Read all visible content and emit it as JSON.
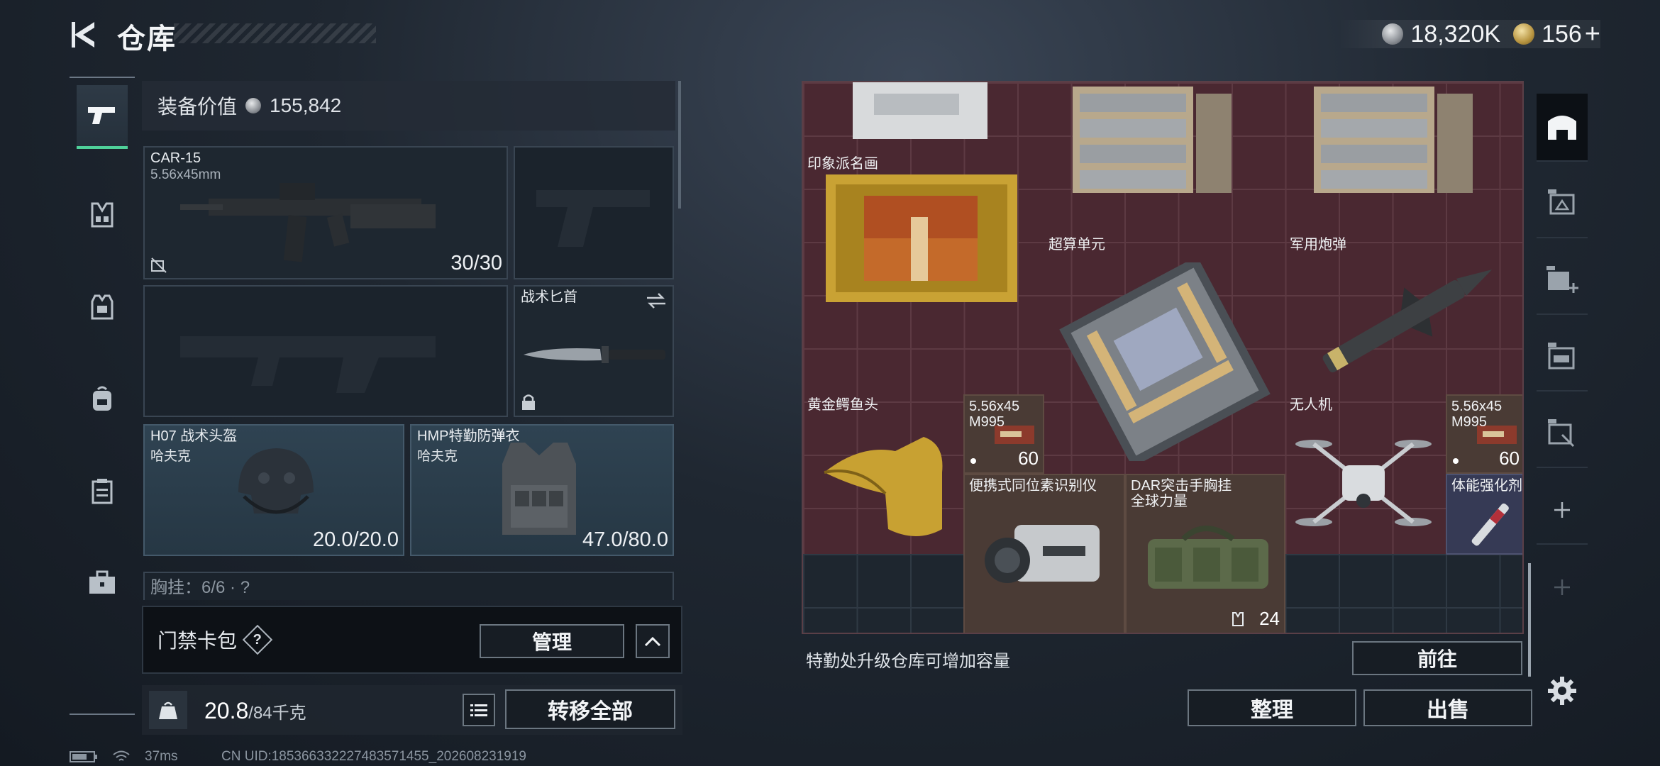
{
  "header": {
    "title": "仓库"
  },
  "currency": [
    {
      "icon": "silver-coin-icon",
      "value": "18,320K"
    },
    {
      "icon": "gold-coin-icon",
      "value": "156"
    }
  ],
  "currency_add": "+",
  "equipment": {
    "value_label": "装备价值",
    "value": "155,842",
    "primary_weapon": {
      "name": "CAR-15",
      "caliber": "5.56x45mm",
      "ammo": "30/30"
    },
    "knife": {
      "name": "战术匕首"
    },
    "helmet": {
      "name": "H07 战术头盔",
      "brand": "哈夫克",
      "durability": "20.0/20.0"
    },
    "armor": {
      "name": "HMP特勤防弹衣",
      "brand": "哈夫克",
      "durability": "47.0/80.0"
    },
    "chest_rig_partial": "胸挂：6/6 · ?",
    "card_bag_label": "门禁卡包",
    "help_label": "?",
    "manage_label": "管理",
    "weight_current": "20.8",
    "weight_max": "/84千克",
    "transfer_all_label": "转移全部"
  },
  "stash": {
    "items": [
      {
        "name": "印象派名画",
        "qty": ""
      },
      {
        "name": "超算单元",
        "qty": ""
      },
      {
        "name": "军用炮弹",
        "qty": ""
      },
      {
        "name": "黄金鳄鱼头",
        "qty": ""
      },
      {
        "name": "5.56x45 M995",
        "qty": "60"
      },
      {
        "name": "无人机",
        "qty": ""
      },
      {
        "name": "5.56x45 M995",
        "qty": "60"
      },
      {
        "name": "便携式同位素识别仪",
        "qty": ""
      },
      {
        "name": "DAR突击手胸挂\n全球力量",
        "qty": "24"
      },
      {
        "name": "体能强化剂",
        "qty": ""
      }
    ],
    "upgrade_note": "特勤处升级仓库可增加容量",
    "goto_label": "前往",
    "sort_label": "整理",
    "sell_label": "出售"
  },
  "status": {
    "ping": "37ms",
    "uid": "CN UID:185366332227483571455_202608231919"
  },
  "colors": {
    "accent": "#4fd19a",
    "stash_bg": "#4a2831"
  }
}
